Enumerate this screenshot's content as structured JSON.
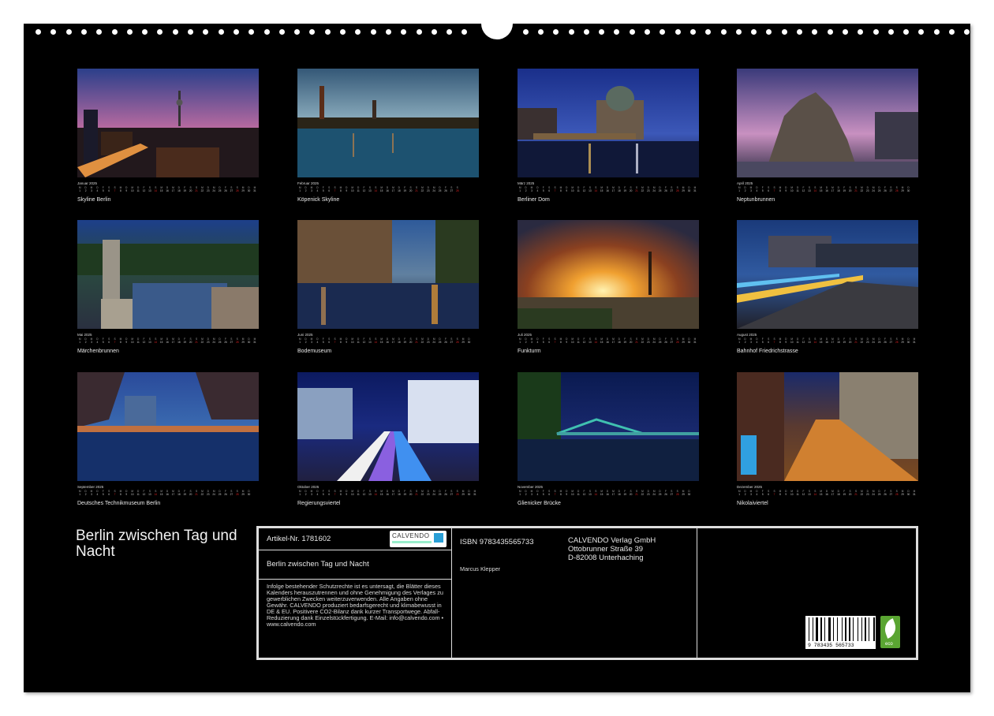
{
  "calendar": {
    "title": "Berlin zwischen Tag und Nacht",
    "weekday_initials": [
      "M",
      "D",
      "M",
      "D",
      "F",
      "S",
      "S",
      "M",
      "D",
      "M",
      "D",
      "F",
      "S",
      "S",
      "M",
      "D",
      "M",
      "D",
      "F",
      "S",
      "S",
      "M",
      "D",
      "M",
      "D",
      "F",
      "S",
      "S",
      "M",
      "D",
      "M"
    ],
    "months": [
      {
        "label": "Januar 2025",
        "caption": "Skyline Berlin",
        "days": 31
      },
      {
        "label": "Februar 2025",
        "caption": "Köpenick Skyline",
        "days": 28
      },
      {
        "label": "März 2025",
        "caption": "Berliner Dom",
        "days": 31
      },
      {
        "label": "April 2025",
        "caption": "Neptunbrunnen",
        "days": 30
      },
      {
        "label": "Mai 2025",
        "caption": "Märchenbrunnen",
        "days": 31
      },
      {
        "label": "Juni 2025",
        "caption": "Bodemuseum",
        "days": 30
      },
      {
        "label": "Juli 2025",
        "caption": "Funkturm",
        "days": 31
      },
      {
        "label": "August 2025",
        "caption": "Bahnhof Friedrichstrasse",
        "days": 31
      },
      {
        "label": "September 2025",
        "caption": "Deutsches Technikmuseum Berlin",
        "days": 30
      },
      {
        "label": "Oktober 2025",
        "caption": "Regierungsviertel",
        "days": 31
      },
      {
        "label": "November 2025",
        "caption": "Glienicker Brücke",
        "days": 30
      },
      {
        "label": "Dezember 2025",
        "caption": "Nikolaiviertel",
        "days": 31
      }
    ]
  },
  "info": {
    "article": "Artikel-Nr. 1781602",
    "logo_text": "CALVENDO",
    "title": "Berlin zwischen Tag und Nacht",
    "legal": "Infolge bestehender Schutzrechte ist es untersagt, die Blätter dieses Kalenders herauszutrennen und ohne Genehmigung des Verlages zu gewerblichen Zwecken weiterzuverwenden. Alle Angaben ohne Gewähr. CALVENDO produziert bedarfsgerecht und klimabewusst in DE & EU. Positivere CO2-Bilanz dank kurzer Transportwege. Abfall-Reduzierung dank Einzelstückfertigung. E-Mail: info@calvendo.com • www.calvendo.com",
    "isbn": "ISBN 9783435565733",
    "author": "Marcus Klepper",
    "publisher_name": "CALVENDO Verlag GmbH",
    "publisher_street": "Ottobrunner Straße 39",
    "publisher_city": "D-82008 Unterhaching",
    "barcode_digits": "9 783435 565733",
    "eco_label": "eco"
  },
  "colors": {
    "background": "#000000",
    "sunday": "#e02020",
    "eco_green": "#5aa532"
  }
}
